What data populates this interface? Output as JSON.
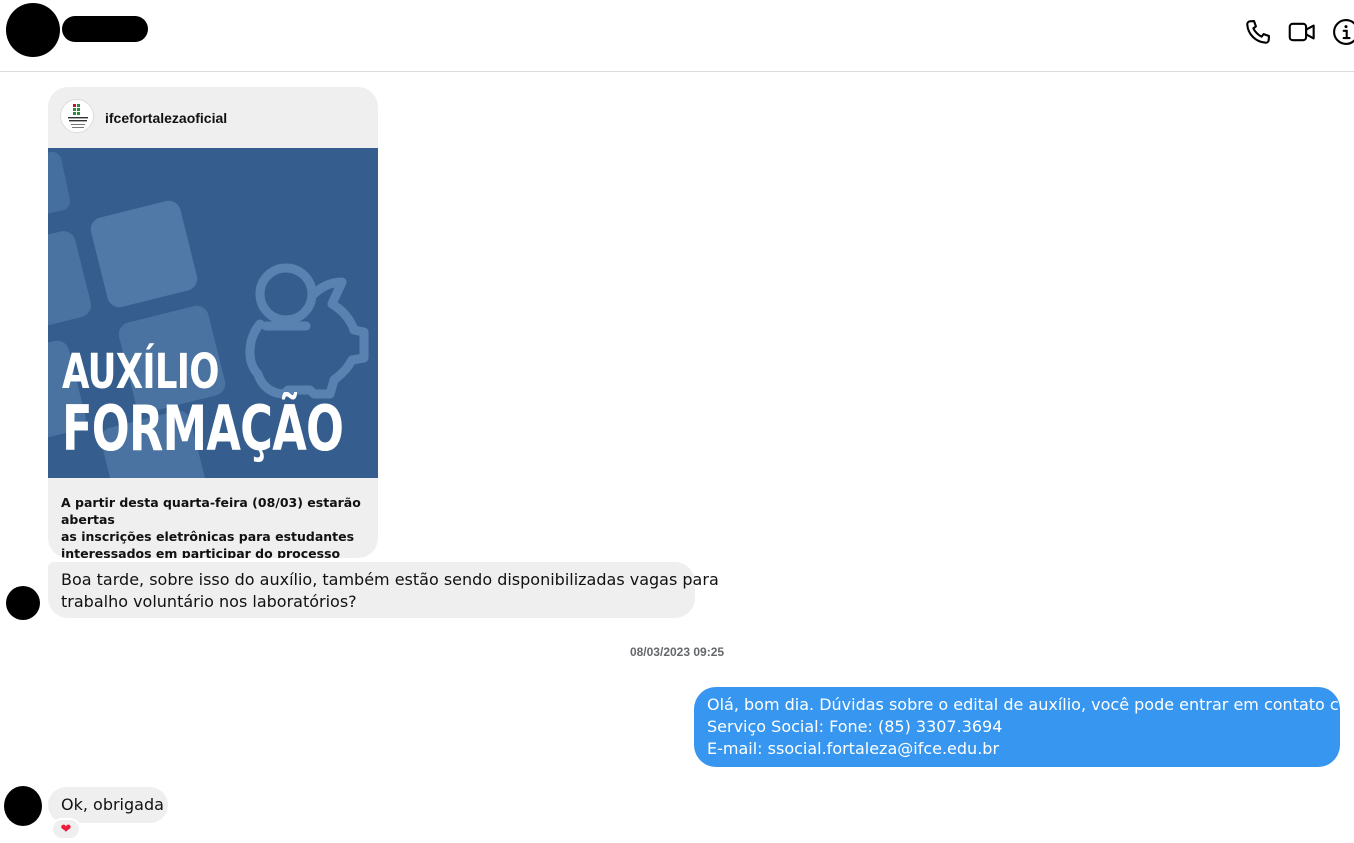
{
  "header": {
    "icons": {
      "call": "phone-icon",
      "video": "video-camera-icon",
      "info": "info-icon"
    }
  },
  "shared_post": {
    "username": "ifcefortalezaoficial",
    "image_title_line1": "AUXÍLIO",
    "image_title_line2": "FORMAÇÃO",
    "caption_lines": [
      "A partir desta quarta-feira (08/03) estarão abertas",
      "as inscrições eletrônicas para estudantes",
      "interessados em participar do processo seletivo..."
    ]
  },
  "messages": [
    {
      "direction": "incoming",
      "lines": [
        "Boa tarde, sobre isso do auxílio, também estão sendo disponibilizadas vagas para",
        "trabalho voluntário nos laboratórios?"
      ]
    },
    {
      "direction": "outgoing",
      "lines": [
        "Olá, bom dia. Dúvidas sobre o edital de auxílio, você pode entrar em contato com o",
        "Serviço Social: Fone: (85) 3307.3694",
        "E-mail: ssocial.fortaleza@ifce.edu.br"
      ]
    },
    {
      "direction": "incoming",
      "lines": [
        "Ok, obrigada"
      ],
      "reaction": "❤"
    }
  ],
  "timestamp": "08/03/2023 09:25",
  "colors": {
    "outgoing_bubble": "#3797f0",
    "incoming_bubble": "#efefef",
    "post_image_bg": "#355e8f",
    "reaction_heart": "#ed1c3a"
  }
}
